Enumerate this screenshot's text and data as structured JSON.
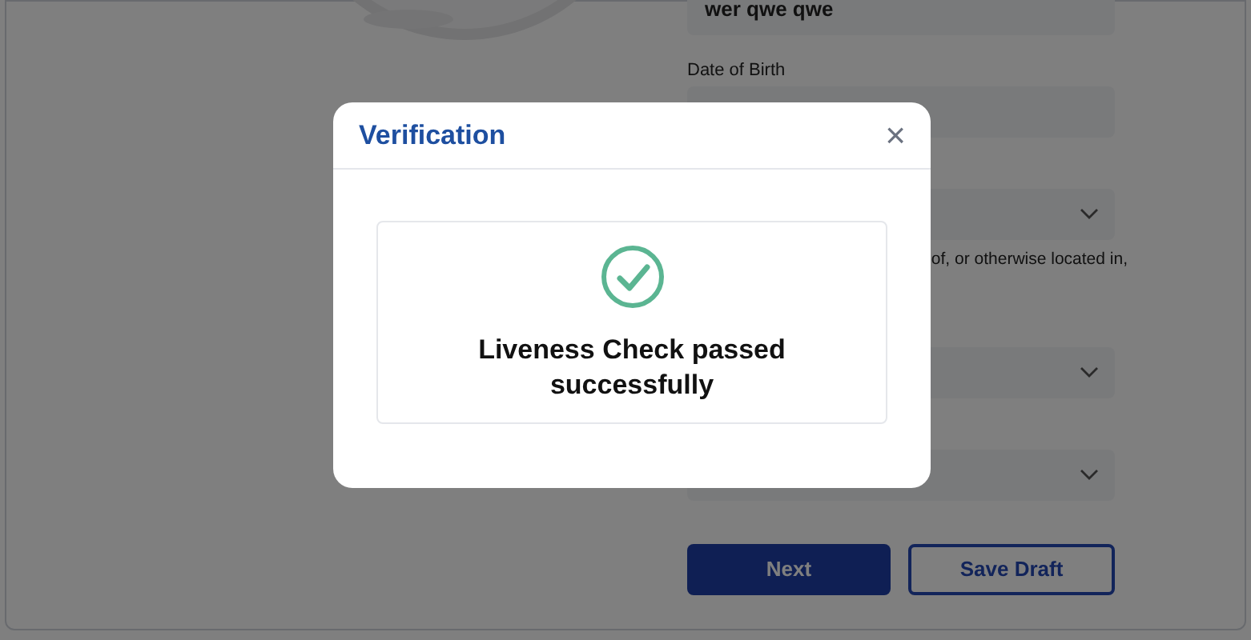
{
  "form": {
    "rows": [
      {
        "kind": "input",
        "value": "wer qwe qwe"
      },
      {
        "kind": "label",
        "text": "Date of Birth"
      },
      {
        "kind": "input",
        "value": ""
      },
      {
        "kind": "select"
      },
      {
        "kind": "note",
        "text": "of, or otherwise located in,"
      },
      {
        "kind": "select"
      },
      {
        "kind": "select"
      }
    ],
    "buttons": [
      {
        "label": "Next",
        "kind": "primary"
      },
      {
        "label": "Save Draft",
        "kind": "secondary"
      }
    ]
  },
  "dialog": {
    "title": "Verification",
    "close": "×",
    "message": "Liveness Check passed successfully"
  }
}
